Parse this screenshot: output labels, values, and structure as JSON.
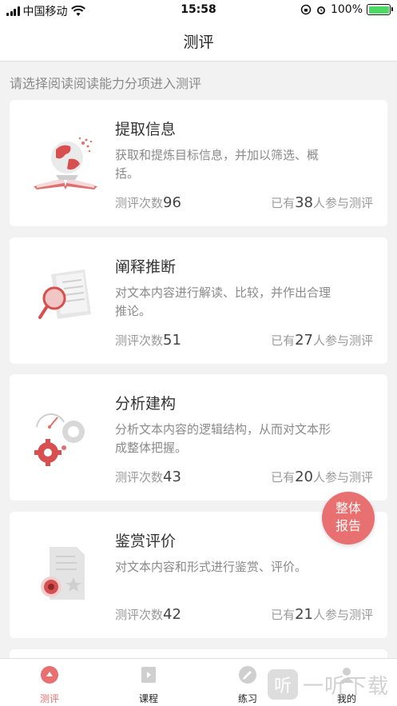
{
  "status_bar": {
    "carrier": "中国移动",
    "time": "15:58",
    "battery": "100%",
    "battery_level": 1.0
  },
  "nav": {
    "title": "测评"
  },
  "subtitle": "请选择阅读阅读能力分项进入测评",
  "cards": [
    {
      "name": "提取信息",
      "desc": "获取和提炼目标信息，并加以筛选、概括。",
      "count_label": "测评次数",
      "count": "96",
      "people_prefix": "已有",
      "people": "38",
      "people_suffix": "人参与测评",
      "icon": "globe-book-icon"
    },
    {
      "name": "阐释推断",
      "desc": "对文本内容进行解读、比较，并作出合理推论。",
      "count_label": "测评次数",
      "count": "51",
      "people_prefix": "已有",
      "people": "27",
      "people_suffix": "人参与测评",
      "icon": "magnifier-document-icon"
    },
    {
      "name": "分析建构",
      "desc": "分析文本内容的逻辑结构，从而对文本形成整体把握。",
      "count_label": "测评次数",
      "count": "43",
      "people_prefix": "已有",
      "people": "20",
      "people_suffix": "人参与测评",
      "icon": "gears-icon"
    },
    {
      "name": "鉴赏评价",
      "desc": "对文本内容和形式进行鉴赏、评价。",
      "count_label": "测评次数",
      "count": "42",
      "people_prefix": "已有",
      "people": "21",
      "people_suffix": "人参与测评",
      "icon": "eye-document-icon"
    }
  ],
  "fab": {
    "line1": "整体",
    "line2": "报告"
  },
  "tabs": [
    {
      "label": "测评",
      "icon": "assessment-icon",
      "active": true
    },
    {
      "label": "课程",
      "icon": "course-icon",
      "active": false
    },
    {
      "label": "练习",
      "icon": "practice-icon",
      "active": false
    },
    {
      "label": "我的",
      "icon": "profile-icon",
      "active": false
    }
  ],
  "watermark": {
    "glyph": "听",
    "text": "一听下载"
  },
  "colors": {
    "accent": "#e87070",
    "background": "#f2f2f2",
    "battery": "#4cd964"
  }
}
